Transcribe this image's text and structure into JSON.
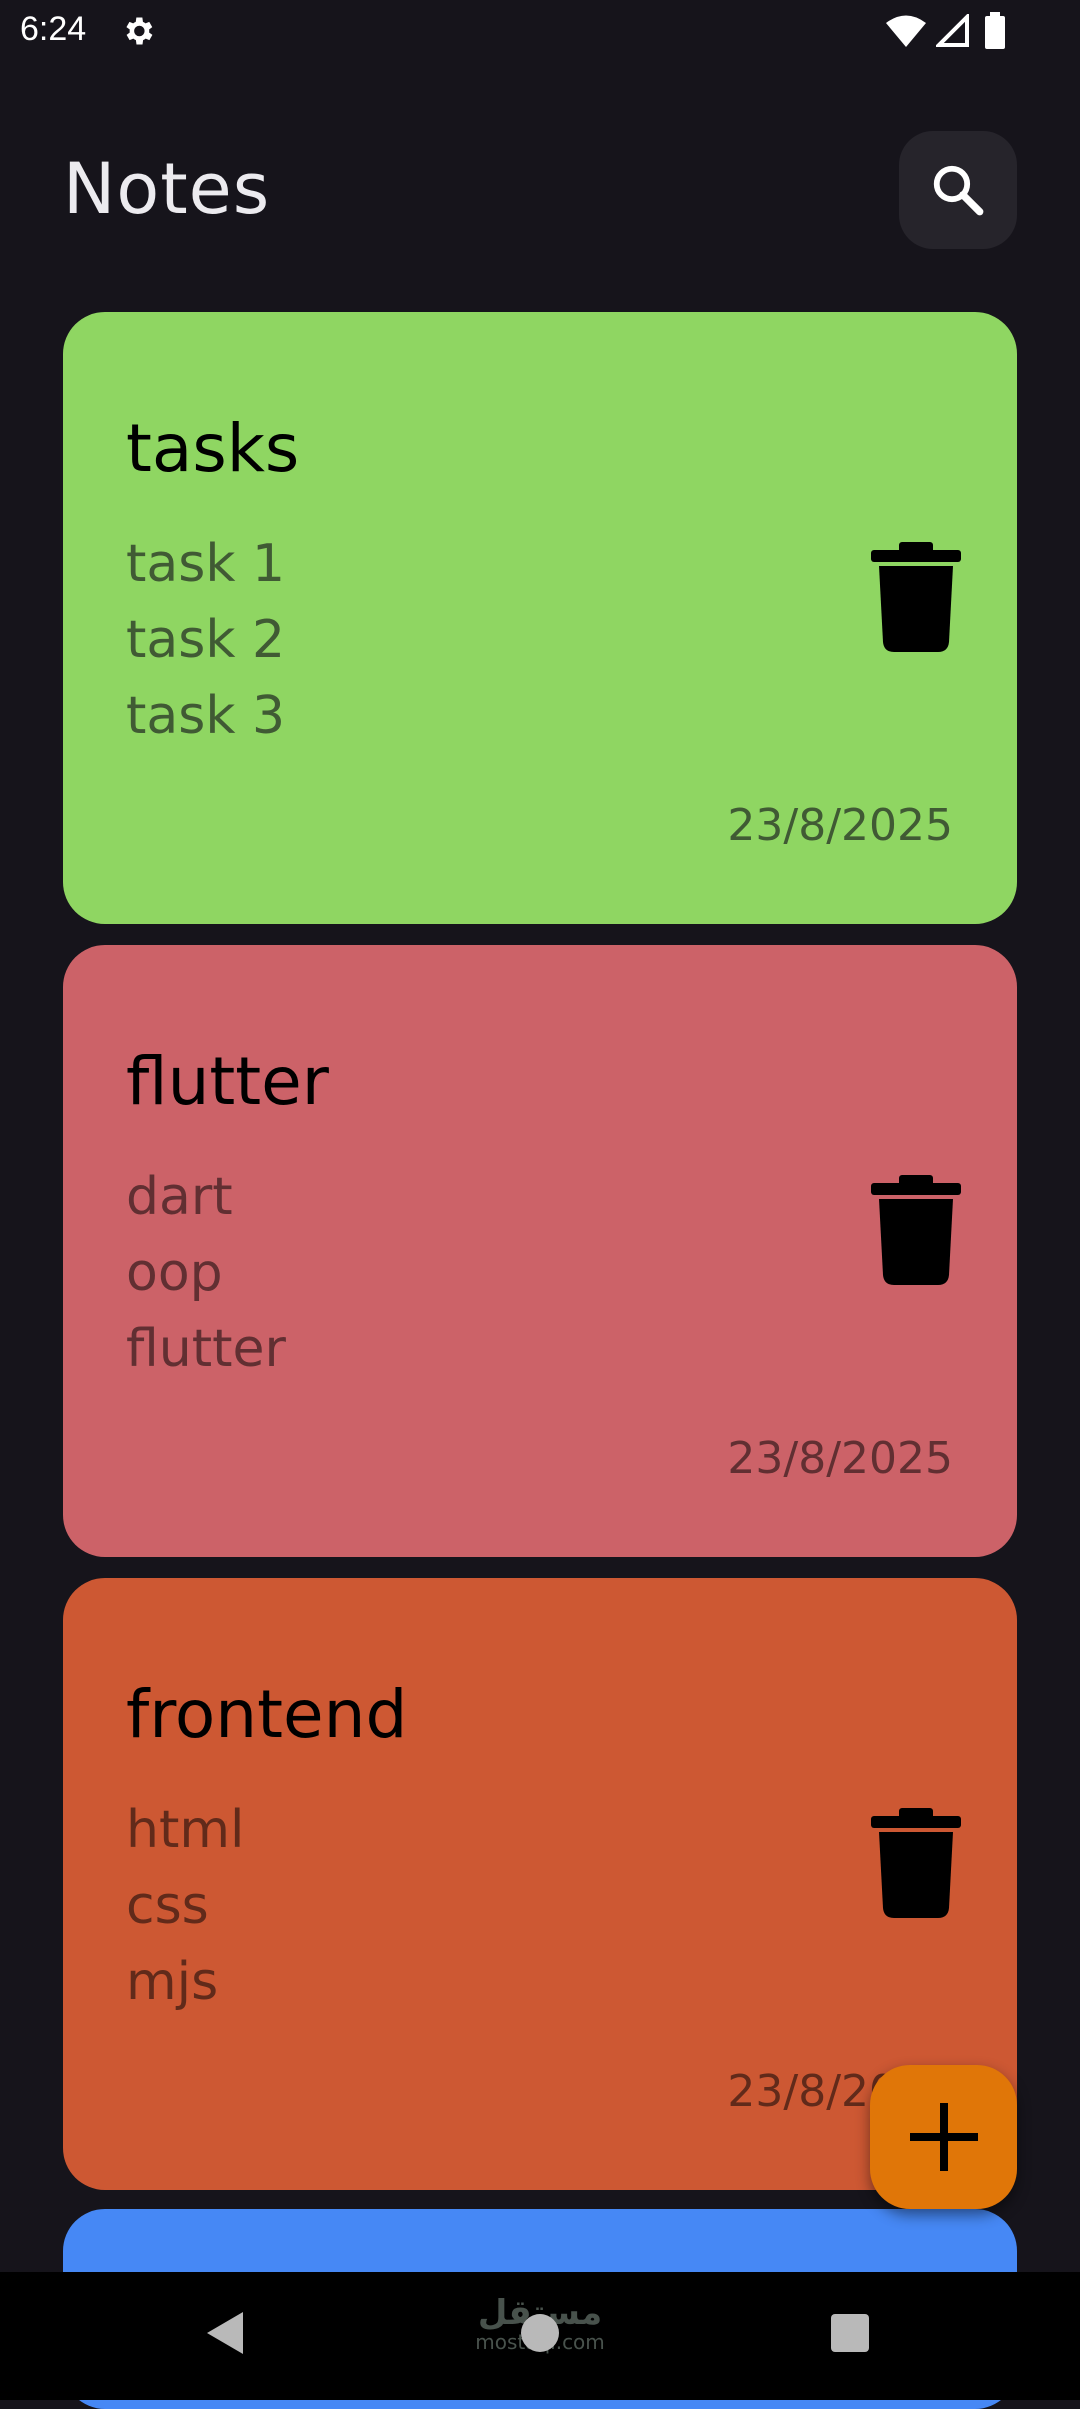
{
  "status_bar": {
    "time": "6:24",
    "icons": [
      "settings-gear-icon",
      "wifi-icon",
      "cell-signal-icon",
      "battery-icon"
    ]
  },
  "header": {
    "title": "Notes",
    "search_icon": "search-icon"
  },
  "notes": [
    {
      "title": "tasks",
      "lines": [
        "task 1",
        "task 2",
        "task 3"
      ],
      "date": "23/8/2025",
      "color": "#8fd662",
      "text_color": "#405a34"
    },
    {
      "title": "flutter",
      "lines": [
        "dart",
        "oop",
        "flutter"
      ],
      "date": "23/8/2025",
      "color": "#cc6268",
      "text_color": "#612f32"
    },
    {
      "title": "frontend",
      "lines": [
        "html",
        "css",
        "mjs"
      ],
      "date": "23/8/2025",
      "color": "#cd5833",
      "text_color": "#612a1a"
    },
    {
      "color": "#4688f5"
    }
  ],
  "fab": {
    "icon": "plus-icon",
    "color": "#e07608"
  },
  "watermark": {
    "arabic": "مستقل",
    "latin": "mostaql.com"
  },
  "nav_bar": {
    "icons": [
      "back-icon",
      "home-icon",
      "recents-icon"
    ]
  }
}
